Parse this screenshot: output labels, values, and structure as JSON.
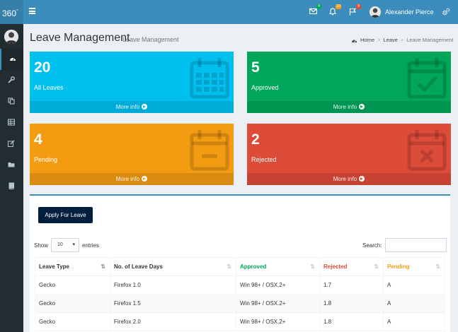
{
  "app": {
    "logo": "360",
    "logo_sup": "°"
  },
  "user": {
    "name": "Alexander Pierce"
  },
  "notifications": [
    {
      "icon": "envelope-icon",
      "count": "4",
      "color": "#00a65a"
    },
    {
      "icon": "bell-icon",
      "count": "10",
      "color": "#f39c12"
    },
    {
      "icon": "flag-icon",
      "count": "9",
      "color": "#dd4b39"
    }
  ],
  "header": {
    "title": "Leave Management",
    "subtitle": "Leave Management",
    "breadcrumb": [
      "Home",
      "Leave",
      "Leave Management"
    ]
  },
  "stats": [
    {
      "value": "20",
      "label": "All Leaves",
      "more": "More info",
      "color": "#00c0ef",
      "icon": "calendar-icon"
    },
    {
      "value": "5",
      "label": "Approved",
      "more": "More info",
      "color": "#00a65a",
      "icon": "calendar-check-icon"
    },
    {
      "value": "4",
      "label": "Pending",
      "more": "More info",
      "color": "#f39c12",
      "icon": "calendar-minus-icon"
    },
    {
      "value": "2",
      "label": "Rejected",
      "more": "More info",
      "color": "#dd4b39",
      "icon": "calendar-times-icon"
    }
  ],
  "panel": {
    "apply_label": "Apply For Leave",
    "show_label": "Show",
    "entries_value": "10",
    "entries_label": "entries",
    "search_label": "Search:"
  },
  "table": {
    "columns": [
      {
        "label": "Leave Type",
        "color": "#333"
      },
      {
        "label": "No. of Leave Days",
        "color": "#333"
      },
      {
        "label": "Approved",
        "color": "#00a65a"
      },
      {
        "label": "Rejected",
        "color": "#dd4b39"
      },
      {
        "label": "Pending",
        "color": "#f39c12"
      }
    ],
    "rows": [
      [
        "Gecko",
        "Firefox 1.0",
        "Win 98+ / OSX.2+",
        "1.7",
        "A"
      ],
      [
        "Gecko",
        "Firefox 1.5",
        "Win 98+ / OSX.2+",
        "1.8",
        "A"
      ],
      [
        "Gecko",
        "Firefox 2.0",
        "Win 98+ / OSX.2+",
        "1.8",
        "A"
      ]
    ]
  }
}
